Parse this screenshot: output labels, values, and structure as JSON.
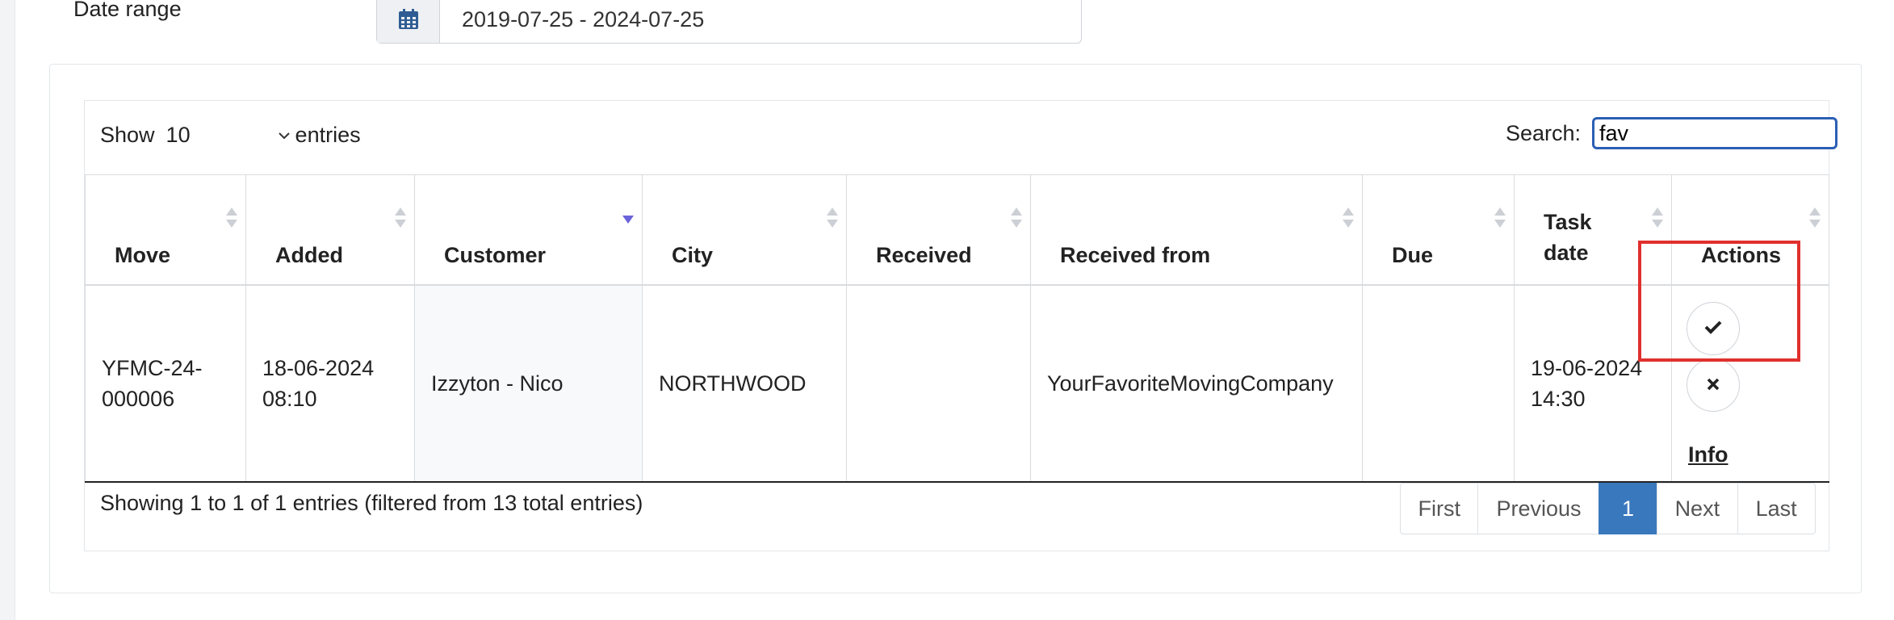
{
  "filters": {
    "date_range_label": "Date range",
    "date_range_value": "2019-07-25 - 2024-07-25"
  },
  "table_controls": {
    "show_label": "Show",
    "entries_value": "10",
    "entries_label": "entries",
    "search_label": "Search:",
    "search_value": "fav"
  },
  "columns": [
    "Move",
    "Added",
    "Customer",
    "City",
    "Received",
    "Received from",
    "Due",
    "Task date",
    "Actions"
  ],
  "rows": [
    {
      "move": "YFMC-24-000006",
      "added": "18-06-2024 08:10",
      "customer": "Izzyton - Nico",
      "city": "NORTHWOOD",
      "received": "",
      "received_from": "YourFavoriteMovingCompany",
      "due": "",
      "task_date": "19-06-2024 14:30",
      "info_label": "Info"
    }
  ],
  "footer": {
    "info": "Showing 1 to 1 of 1 entries (filtered from 13 total entries)",
    "pagination": {
      "first": "First",
      "previous": "Previous",
      "current": "1",
      "next": "Next",
      "last": "Last"
    }
  },
  "icons": {
    "date": "calendar-icon",
    "approve": "check-icon",
    "reject": "x-icon"
  },
  "colors": {
    "accent": "#3a78bd",
    "search_border": "#2b5fb4",
    "highlight_box": "#e0302d",
    "sort_active": "#6b63d9"
  }
}
